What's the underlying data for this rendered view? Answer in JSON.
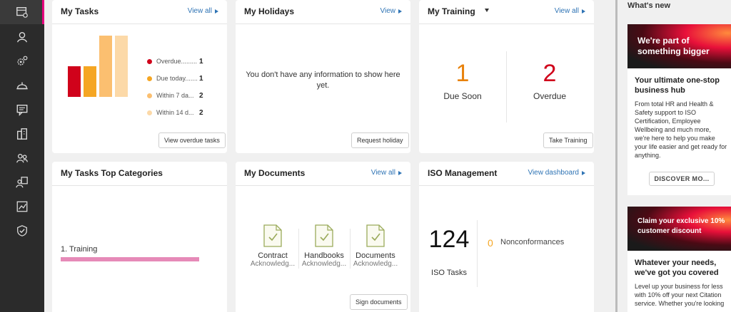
{
  "nav": {
    "items": [
      {
        "icon": "dashboard-icon",
        "active": true
      },
      {
        "icon": "person-icon"
      },
      {
        "icon": "gears-icon"
      },
      {
        "icon": "hard-hat-icon"
      },
      {
        "icon": "message-icon"
      },
      {
        "icon": "buildings-icon"
      },
      {
        "icon": "people-icon"
      },
      {
        "icon": "team-icon"
      },
      {
        "icon": "trend-chart-icon"
      },
      {
        "icon": "shield-check-icon"
      }
    ],
    "accent": "#e6007e"
  },
  "my_tasks": {
    "title": "My Tasks",
    "link": "View all",
    "button": "View overdue tasks",
    "chart_data": {
      "type": "bar",
      "categories": [
        "Overdue",
        "Due today",
        "Within 7 days",
        "Within 14 days"
      ],
      "values": [
        1,
        1,
        2,
        2
      ],
      "colors": [
        "#d0021b",
        "#f5a623",
        "#fbbf70",
        "#fcd9a8"
      ]
    },
    "legend": [
      {
        "label": "Overdue.........",
        "value": "1",
        "color": "#d0021b"
      },
      {
        "label": "Due today.......",
        "value": "1",
        "color": "#f5a623"
      },
      {
        "label": "Within 7 da...",
        "value": "2",
        "color": "#fbbf70"
      },
      {
        "label": "Within 14 d...",
        "value": "2",
        "color": "#fcd9a8"
      }
    ]
  },
  "my_holidays": {
    "title": "My Holidays",
    "link": "View",
    "message": "You don't have any information to show here yet.",
    "button": "Request holiday"
  },
  "my_training": {
    "title": "My Training",
    "due_soon_value": "1",
    "due_soon_label": "Due Soon",
    "overdue_value": "2",
    "overdue_label": "Overdue",
    "link": "View all",
    "button": "Take Training",
    "colors": {
      "due_soon": "#e8820c",
      "overdue": "#d0021b"
    }
  },
  "top_categories": {
    "title": "My Tasks Top Categories",
    "items": [
      {
        "label": "1. Training",
        "fraction": 1.0,
        "color": "#e68ab8"
      }
    ]
  },
  "my_documents": {
    "title": "My Documents",
    "link": "View all",
    "docs": [
      {
        "name": "Contract",
        "sub": "Acknowledg..."
      },
      {
        "name": "Handbooks",
        "sub": "Acknowledg..."
      },
      {
        "name": "Documents",
        "sub": "Acknowledg..."
      }
    ],
    "button": "Sign documents"
  },
  "iso": {
    "title": "ISO Management",
    "link": "View dashboard",
    "tasks_value": "124",
    "tasks_label": "ISO Tasks",
    "nc_value": "0",
    "nc_label": "Nonconformances"
  },
  "whats_new": {
    "title": "What's new",
    "promos": [
      {
        "banner": "We're part of something bigger",
        "heading": "Your ultimate one-stop business hub",
        "body": "From total HR and Health & Safety support to ISO Certification, Employee Wellbeing and much more, we're here to help you make your life easier and get ready for anything.",
        "button": "DISCOVER MO..."
      },
      {
        "banner": "Claim your exclusive 10% customer discount",
        "heading": "Whatever your needs, we've got you covered",
        "body": "Level up your business for less with 10% off your next Citation service. Whether you're looking"
      }
    ]
  }
}
